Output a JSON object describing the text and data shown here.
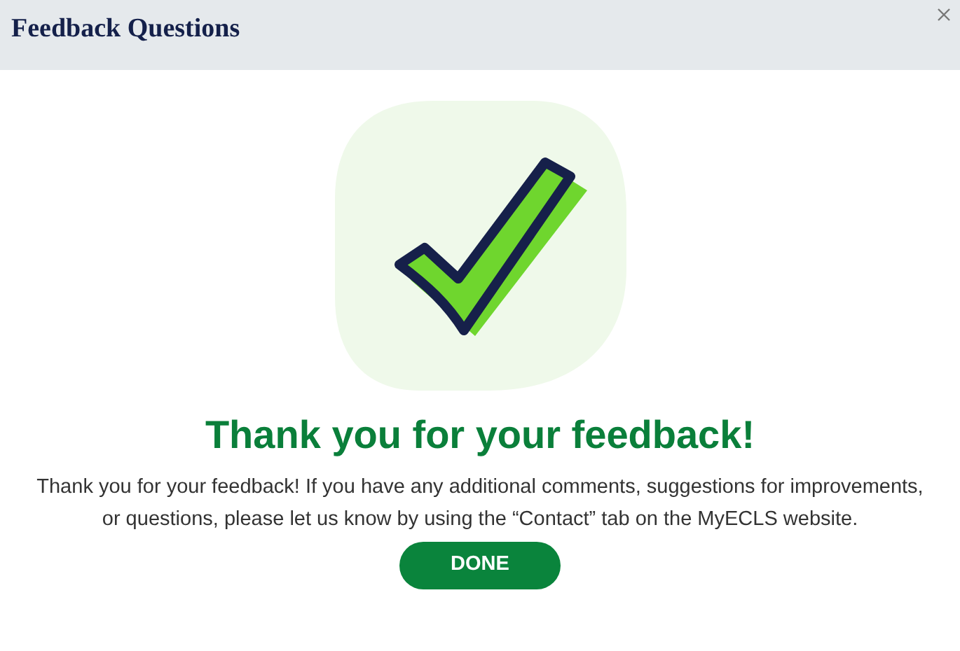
{
  "dialog": {
    "title": "Feedback Questions"
  },
  "heading": "Thank you for your feedback!",
  "message": "Thank you for your feedback! If you have any additional comments, suggestions for improvements, or questions, please let us know by using the “Contact” tab on the MyECLS website.",
  "buttons": [
    {
      "label": "DONE"
    }
  ]
}
